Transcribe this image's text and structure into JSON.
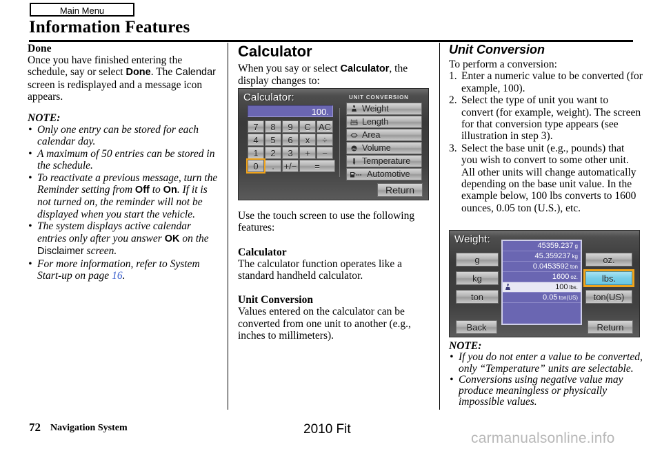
{
  "header": {
    "tab_label": "Main Menu",
    "title": "Information Features"
  },
  "left_column": {
    "section_title": "Done",
    "body": "Once you have finished entering the schedule, say or select ",
    "body_term1": "Done",
    "body_cont1": ". The ",
    "body_term2": "Calendar",
    "body_cont2": " screen is redisplayed and a message icon appears.",
    "note_label": "NOTE:",
    "notes": [
      "Only one entry can be stored for each calendar day.",
      "A maximum of 50 entries can be stored in the schedule.",
      "To reactivate a previous message, turn the Reminder setting from Off to On. If it is not turned on, the reminder will not be displayed when you start the vehicle.",
      "The system displays active calendar entries only after you answer OK on the Disclaimer screen.",
      "For more information, refer to System Start-up on page 16."
    ],
    "note3_a": "To reactivate a previous message, turn the Reminder setting from ",
    "note3_off": "Off",
    "note3_b": " to ",
    "note3_on": "On",
    "note3_c": ". If it is not turned on, the reminder will not be displayed when you start the vehicle.",
    "note4_a": "The system displays active calendar entries only after you answer ",
    "note4_ok": "OK",
    "note4_b": " on the ",
    "note4_disclaimer": "Disclaimer",
    "note4_c": " screen.",
    "note5_a": "For more information, refer to System Start-up on page ",
    "note5_page": "16",
    "note5_b": "."
  },
  "mid_column": {
    "section_title": "Calculator",
    "intro_a": "When you say or select ",
    "intro_term": "Calculator",
    "intro_b": ", the display changes to:",
    "after_image": "Use the touch screen to use the following features:",
    "sub1_title": "Calculator",
    "sub1_body": "The calculator function operates like a standard handheld calculator.",
    "sub2_title": "Unit Conversion",
    "sub2_body": "Values entered on the calculator can be converted from one unit to another (e.g., inches to millimeters)."
  },
  "right_column": {
    "section_title": "Unit Conversion",
    "intro": "To perform a conversion:",
    "steps": [
      "Enter a numeric value to be converted (for example, 100).",
      "Select the type of unit you want to convert (for example, weight). The screen for that conversion type appears (see illustration in step 3).",
      "Select the base unit (e.g., pounds) that you wish to convert to some other unit. All other units will change automatically depending on the base unit value. In the example below, 100 lbs converts to 1600 ounces, 0.05 ton (U.S.), etc."
    ],
    "note_label": "NOTE:",
    "notes": [
      "If you do not enter a value to be converted, only “Temperature” units are selectable.",
      "Conversions using negative value may produce meaningless or physically impossible values."
    ]
  },
  "calculator_screen": {
    "title": "Calculator:",
    "display_value": "100.",
    "unit_conversion_label": "UNIT CONVERSION",
    "keypad": [
      [
        "7",
        "8",
        "9",
        "C",
        "AC"
      ],
      [
        "4",
        "5",
        "6",
        "x",
        "÷"
      ],
      [
        "1",
        "2",
        "3",
        "+",
        "−"
      ],
      [
        "0",
        ".",
        "+/−",
        "="
      ]
    ],
    "selected_key": "0",
    "unit_buttons": [
      {
        "label": "Weight",
        "icon": "weight-scale-icon"
      },
      {
        "label": "Length",
        "icon": "ruler-icon"
      },
      {
        "label": "Area",
        "icon": "diamond-icon"
      },
      {
        "label": "Volume",
        "icon": "beaker-icon"
      },
      {
        "label": "Temperature",
        "icon": "thermometer-icon"
      },
      {
        "label": "Automotive",
        "icon": "fuel-pump-icon"
      }
    ],
    "return_label": "Return",
    "colors": {
      "lcd": "#6a66b2",
      "selection": "#f0a31b"
    }
  },
  "weight_screen": {
    "title": "Weight:",
    "left_buttons": [
      "g",
      "kg",
      "ton"
    ],
    "right_buttons": [
      "oz.",
      "lbs.",
      "ton(US)"
    ],
    "selected_right_button": "lbs.",
    "rows": [
      {
        "value": "45359.237",
        "unit": "g",
        "highlighted": false
      },
      {
        "value": "45.359237",
        "unit": "kg",
        "highlighted": false
      },
      {
        "value": "0.0453592",
        "unit": "ton",
        "highlighted": false
      },
      {
        "value": "1600",
        "unit": "oz.",
        "highlighted": false
      },
      {
        "value": "100",
        "unit": "lbs.",
        "highlighted": true
      },
      {
        "value": "0.05",
        "unit": "ton(US)",
        "highlighted": false
      }
    ],
    "back_label": "Back",
    "return_label": "Return",
    "colors": {
      "lcd": "#6a66b2",
      "selected_button": "#79cfe8",
      "selection_border": "#f0a31b"
    }
  },
  "footer": {
    "page_number": "72",
    "book_title": "Navigation System",
    "model": "2010 Fit",
    "watermark": "carmanualsonline.info"
  }
}
